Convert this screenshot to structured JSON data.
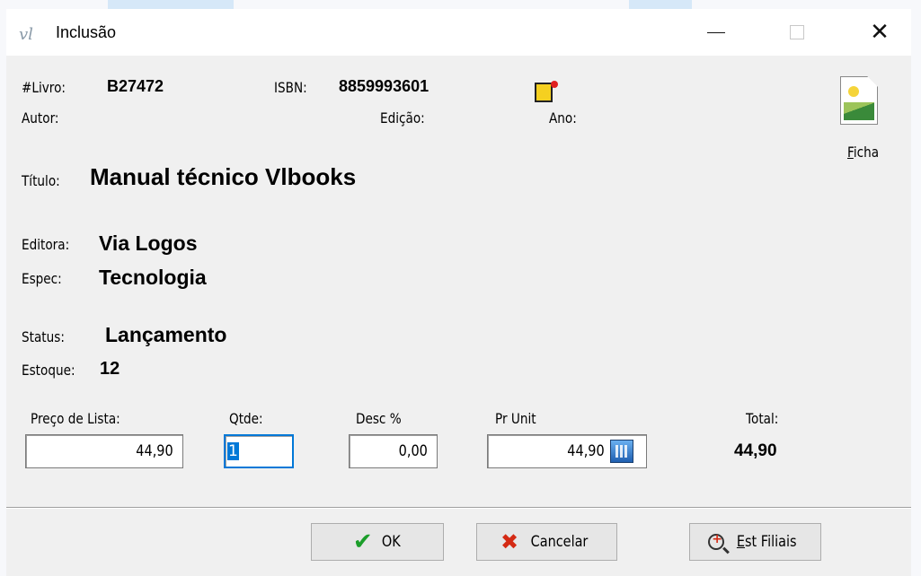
{
  "window": {
    "title": "Inclusão",
    "logo": "vl"
  },
  "book": {
    "livro_label": "#Livro:",
    "livro_value": "B27472",
    "isbn_label": "ISBN:",
    "isbn_value": "8859993601",
    "autor_label": "Autor:",
    "edicao_label": "Edição:",
    "ano_label": "Ano:",
    "titulo_label": "Título:",
    "titulo_value": "Manual técnico Vlbooks",
    "editora_label": "Editora:",
    "editora_value": "Via Logos",
    "espec_label": "Espec:",
    "espec_value": "Tecnologia",
    "status_label": "Status:",
    "status_value": "Lançamento",
    "estoque_label": "Estoque:",
    "estoque_value": "12"
  },
  "ficha": {
    "label_accel": "F",
    "label_rest": "icha"
  },
  "pricing": {
    "preco_label": "Preço de Lista:",
    "preco_value": "44,90",
    "qtde_label": "Qtde:",
    "qtde_value": "1",
    "desc_label": "Desc %",
    "desc_value": "0,00",
    "prunit_label": "Pr Unit",
    "prunit_value": "44,90",
    "total_label": "Total:",
    "total_value": "44,90"
  },
  "buttons": {
    "ok": "OK",
    "cancel": "Cancelar",
    "filiais_accel": "E",
    "filiais_rest": "st Filiais"
  },
  "colors": {
    "accent": "#0078d7",
    "ok_green": "#1b9e2a",
    "cancel_red": "#d42a14"
  }
}
